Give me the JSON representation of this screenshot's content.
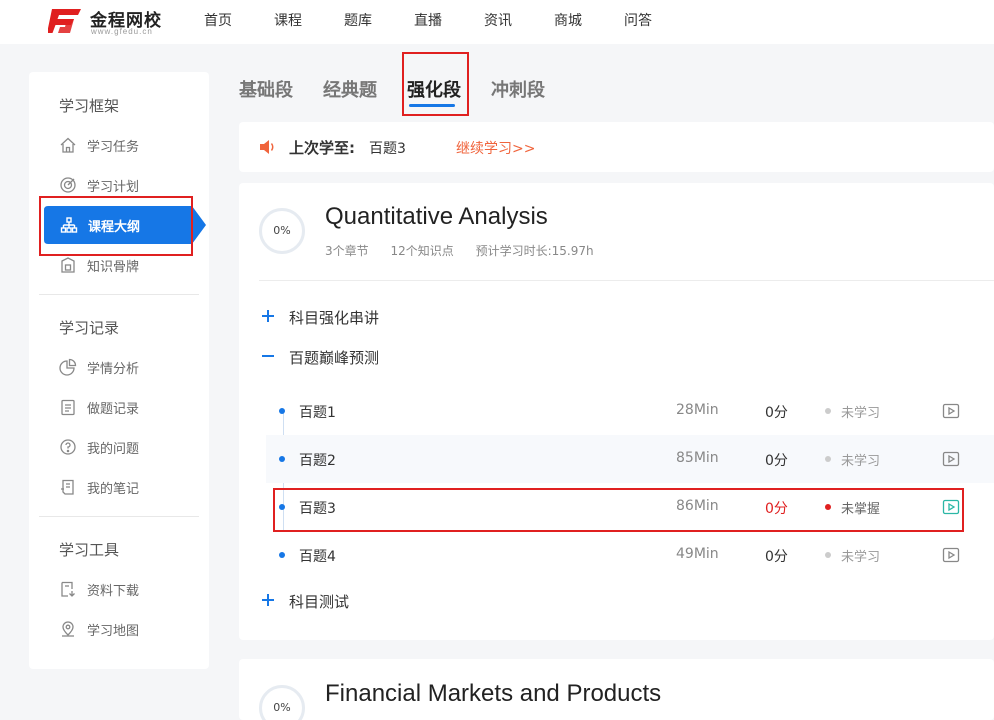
{
  "site": {
    "logo_name": "金程网校",
    "logo_url": "www.gfedu.cn",
    "brand_color": "#e02020",
    "accent_color": "#1677e6",
    "nav": [
      "首页",
      "课程",
      "题库",
      "直播",
      "资讯",
      "商城",
      "问答"
    ]
  },
  "sidebar": {
    "groups": [
      {
        "title": "学习框架",
        "items": [
          {
            "label": "学习任务",
            "icon": "home-icon"
          },
          {
            "label": "学习计划",
            "icon": "target-icon"
          },
          {
            "label": "课程大纲",
            "icon": "sitemap-icon",
            "active": true
          },
          {
            "label": "知识骨牌",
            "icon": "domino-icon"
          }
        ]
      },
      {
        "title": "学习记录",
        "items": [
          {
            "label": "学情分析",
            "icon": "pie-chart-icon"
          },
          {
            "label": "做题记录",
            "icon": "clipboard-icon"
          },
          {
            "label": "我的问题",
            "icon": "question-icon"
          },
          {
            "label": "我的笔记",
            "icon": "note-icon"
          }
        ]
      },
      {
        "title": "学习工具",
        "items": [
          {
            "label": "资料下载",
            "icon": "download-icon"
          },
          {
            "label": "学习地图",
            "icon": "map-pin-icon"
          }
        ]
      }
    ]
  },
  "tabs": [
    {
      "label": "基础段"
    },
    {
      "label": "经典题"
    },
    {
      "label": "强化段",
      "active": true
    },
    {
      "label": "冲刺段"
    }
  ],
  "last_study": {
    "label": "上次学至:",
    "value": "百题3",
    "continue_link": "继续学习>>"
  },
  "courses": [
    {
      "progress": "0%",
      "title": "Quantitative Analysis",
      "chapters_count": "3个章节",
      "points_count": "12个知识点",
      "duration": "预计学习时长:15.97h",
      "sections": [
        {
          "label": "科目强化串讲",
          "expanded": false
        },
        {
          "label": "百题巅峰预测",
          "expanded": true,
          "lessons": [
            {
              "name": "百题1",
              "duration": "28Min",
              "score": "0分",
              "status": "未学习"
            },
            {
              "name": "百题2",
              "duration": "85Min",
              "score": "0分",
              "status": "未学习"
            },
            {
              "name": "百题3",
              "duration": "86Min",
              "score": "0分",
              "status": "未掌握"
            },
            {
              "name": "百题4",
              "duration": "49Min",
              "score": "0分",
              "status": "未学习"
            }
          ]
        },
        {
          "label": "科目测试",
          "expanded": false
        }
      ]
    },
    {
      "progress": "0%",
      "title": "Financial Markets and Products"
    }
  ]
}
